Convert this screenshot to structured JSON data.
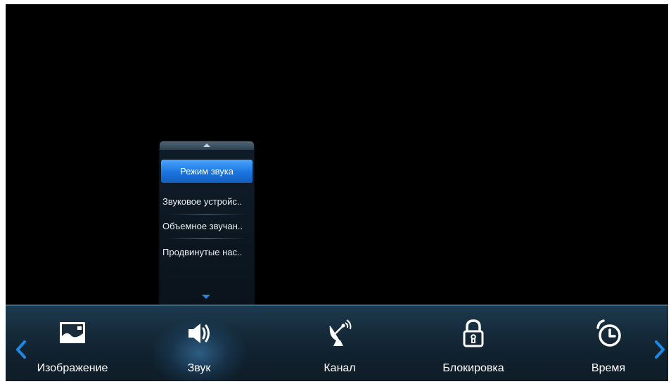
{
  "submenu": {
    "items": [
      {
        "label": "Режим звука",
        "selected": true
      },
      {
        "label": "Звуковое устройс..",
        "selected": false
      },
      {
        "label": "Объемное звучан..",
        "selected": false
      },
      {
        "label": "Продвинутые нас..",
        "selected": false
      }
    ],
    "scroll_up_icon": "triangle-up-icon",
    "scroll_down_icon": "triangle-down-icon"
  },
  "navbar": {
    "prev_icon": "chevron-left-icon",
    "next_icon": "chevron-right-icon",
    "items": [
      {
        "label": "Изображение",
        "icon": "picture-icon",
        "active": false
      },
      {
        "label": "Звук",
        "icon": "speaker-icon",
        "active": true
      },
      {
        "label": "Канал",
        "icon": "satellite-dish-icon",
        "active": false
      },
      {
        "label": "Блокировка",
        "icon": "padlock-icon",
        "active": false
      },
      {
        "label": "Время",
        "icon": "alarm-clock-icon",
        "active": false
      }
    ]
  },
  "colors": {
    "background": "#000000",
    "accent_blue": "#1b74df",
    "navbar_top": "#1d3a4f",
    "chevron": "#1e88e5",
    "text": "#ffffff"
  }
}
